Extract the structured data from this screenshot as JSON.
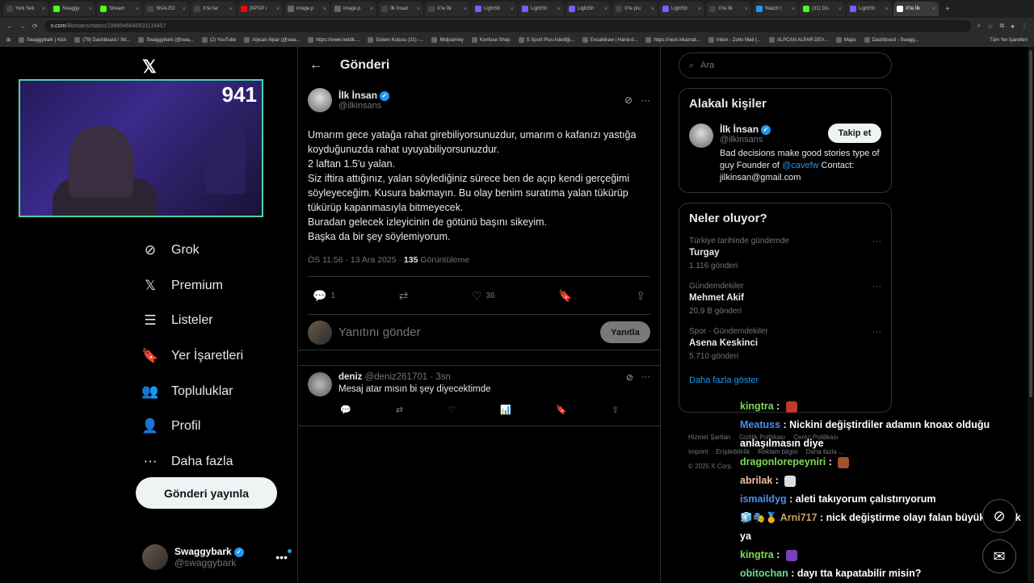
{
  "browser": {
    "tabs": [
      {
        "label": "Yeni Sek",
        "color": "#444"
      },
      {
        "label": "Swaggy",
        "color": "#53fc18"
      },
      {
        "label": "Stream",
        "color": "#53fc18"
      },
      {
        "label": "SKALED",
        "color": "#444"
      },
      {
        "label": "X'te far",
        "color": "#444"
      },
      {
        "label": "[KPOP i",
        "color": "#ff0000"
      },
      {
        "label": "image.p",
        "color": "#666"
      },
      {
        "label": "image.p",
        "color": "#666"
      },
      {
        "label": "İlk İnsan",
        "color": "#444"
      },
      {
        "label": "X'te İlk",
        "color": "#444"
      },
      {
        "label": "LightSh",
        "color": "#7b5cff"
      },
      {
        "label": "LightSh",
        "color": "#7b5cff"
      },
      {
        "label": "LightSh",
        "color": "#7b5cff"
      },
      {
        "label": "X'te plu",
        "color": "#444"
      },
      {
        "label": "LightSh",
        "color": "#7b5cff"
      },
      {
        "label": "X'te İlk",
        "color": "#444"
      },
      {
        "label": "Watch t",
        "color": "#1d9bf0"
      },
      {
        "label": "(31) Dis",
        "color": "#53fc18"
      },
      {
        "label": "LightSh",
        "color": "#7b5cff"
      },
      {
        "label": "X'te İlk",
        "color": "#fff",
        "active": true
      }
    ],
    "url_host": "x.com",
    "url_path": "/ilkinsans/status/1999946640531116457",
    "bookmarks": [
      "Swaggybark | Kick",
      "(79) Dashboard / Str...",
      "Swaggybark (@swa...",
      "(2) YouTube",
      "Alpcan Alpar (@swa...",
      "https://www.reddit....",
      "Golem Kutusu (31) -...",
      "Midjourney",
      "Konfuse Shop",
      "S Sport Plus-İstediği...",
      "Excalidraw | Hand-d...",
      "https://next.inkarnat...",
      "Inbox - Zoho Mail (...",
      "ALPCAN ALPAR DEV...",
      "Maps",
      "Dashboard - Swagg..."
    ],
    "all_bookmarks": "Tüm Yer İşaretleri"
  },
  "stream": {
    "viewer_count": "941"
  },
  "nav": {
    "items": [
      {
        "label": "Grok",
        "icon": "grok-icon",
        "glyph": "⊘"
      },
      {
        "label": "Premium",
        "icon": "x-logo-icon",
        "glyph": "𝕏"
      },
      {
        "label": "Listeler",
        "icon": "list-icon",
        "glyph": "☰"
      },
      {
        "label": "Yer İşaretleri",
        "icon": "bookmark-icon",
        "glyph": "🔖"
      },
      {
        "label": "Topluluklar",
        "icon": "communities-icon",
        "glyph": "👥"
      },
      {
        "label": "Profil",
        "icon": "profile-icon",
        "glyph": "👤"
      },
      {
        "label": "Daha fazla",
        "icon": "more-circle-icon",
        "glyph": "⋯"
      }
    ],
    "post_button": "Gönderi yayınla",
    "account": {
      "name": "Swaggybark",
      "handle": "@swaggybark"
    }
  },
  "main": {
    "header": "Gönderi",
    "tweet": {
      "name": "İlk İnsan",
      "handle": "@ilkinsans",
      "text": "Umarım gece yatağa rahat girebiliyorsunuzdur, umarım o kafanızı yastığa koyduğunuzda rahat uyuyabiliyorsunuzdur.\n2 laftan 1.5'u yalan.\nSiz iftira attığınız, yalan söylediğiniz sürece ben de açıp kendi gerçeğimi söyleyeceğim. Kusura bakmayın. Bu olay benim suratıma yalan tükürüp tükürüp kapanmasıyla bitmeyecek.\nBuradan gelecek izleyicinin de götünü başını sikeyim.\nBaşka da bir şey söylemiyorum.",
      "time": "ÖS 11:56 · 13 Ara 2025 · ",
      "views": "135",
      "views_label": " Görüntüleme",
      "replies": "1",
      "likes": "36"
    },
    "reply_box": {
      "placeholder": "Yanıtını gönder",
      "button": "Yanıtla"
    },
    "reply": {
      "name": "deniz",
      "handle": "@deniz261701 · 3sn",
      "text": "Mesaj atar mısın bi şey diyecektimde"
    }
  },
  "side": {
    "search_placeholder": "Ara",
    "related": {
      "title": "Alakalı kişiler",
      "name": "İlk İnsan",
      "handle": "@ilkinsans",
      "follow": "Takip et",
      "bio_pre": "Bad decisions make good stories type of guy Founder of ",
      "bio_link": "@cavefw",
      "bio_post": " Contact: jilkinsan@gmail.com"
    },
    "trends": {
      "title": "Neler oluyor?",
      "items": [
        {
          "context": "Türkiye tarihinde gündemde",
          "title": "Turgay",
          "count": "1.116 gönderi"
        },
        {
          "context": "Gündemdekiler",
          "title": "Mehmet Akif",
          "count": "20,9 B gönderi"
        },
        {
          "context": "Spor · Gündemdekiler",
          "title": "Asena Keskinci",
          "count": "5.710 gönderi"
        }
      ],
      "more": "Daha fazla göster"
    },
    "footer": [
      "Hizmet Şartları",
      "Gizlilik Politikası",
      "Çerez Politikası",
      "Imprint",
      "Erişilebilirlik",
      "Reklam bilgisi",
      "Daha fazla ...",
      "© 2025 X Corp."
    ]
  },
  "chat": [
    {
      "user": "kingtra",
      "msg": "",
      "cls": "u1",
      "emote": "#c0392b"
    },
    {
      "user": "Meatuss",
      "msg": "Nickini değiştirdiler adamın knoax olduğu anlaşılmasın diye",
      "cls": "u2"
    },
    {
      "user": "dragonlorepeyniri",
      "msg": "",
      "cls": "u1",
      "emote": "#a0522d"
    },
    {
      "user": "abrilak",
      "msg": "",
      "cls": "u3",
      "emote": "#ddd"
    },
    {
      "user": "ismaildyg",
      "msg": "aleti takıyorum çalıstırıyorum",
      "cls": "u2"
    },
    {
      "user": "Arni717",
      "msg": "nick değiştirme olayı falan büyük garplik ya",
      "cls": "u6",
      "prefix": "🧊🎭🏅 "
    },
    {
      "user": "kingtra",
      "msg": "",
      "cls": "u1",
      "emote": "#7b3fbf"
    },
    {
      "user": "obitochan",
      "msg": "dayı tta kapatabilir misin?",
      "cls": "u5"
    }
  ]
}
